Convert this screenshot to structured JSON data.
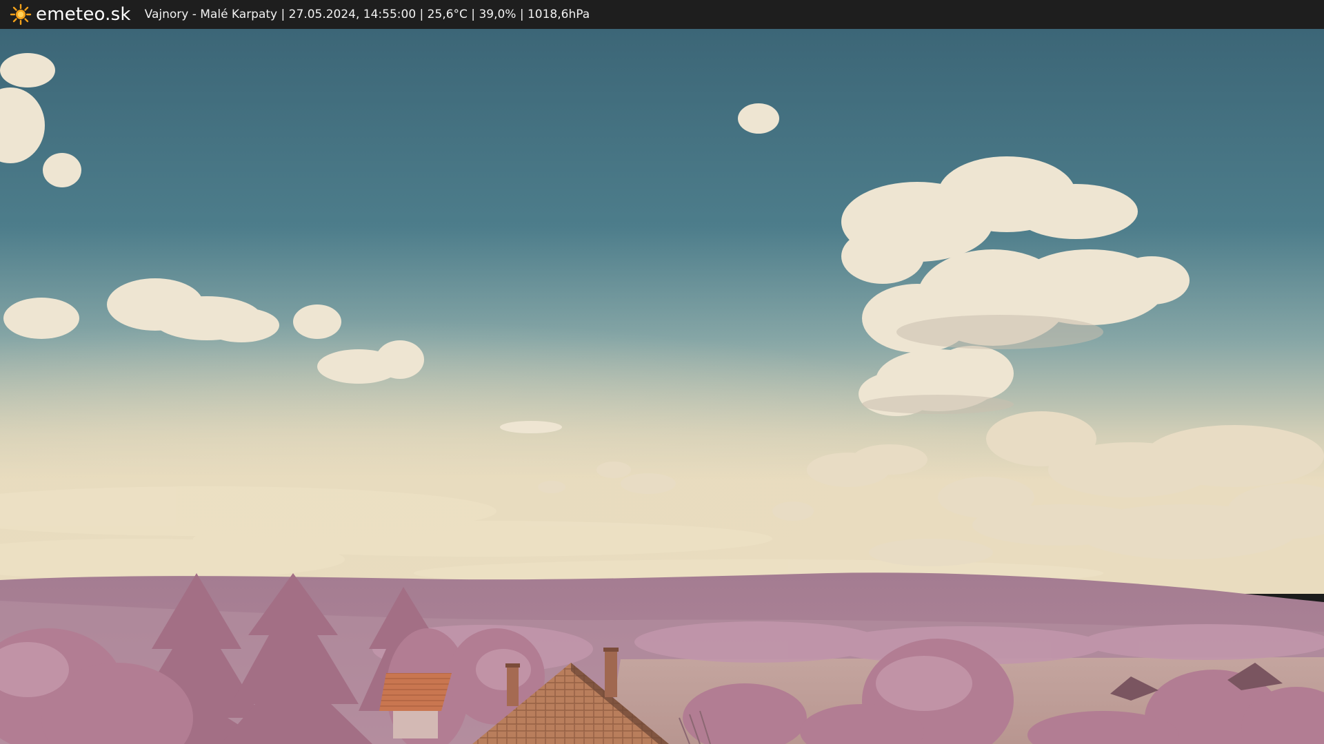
{
  "header": {
    "brand": "emeteo.sk",
    "caption": "Vajnory - Malé Karpaty | 27.05.2024, 14:55:00 | 25,6°C | 39,0% | 1018,6hPa",
    "brand_icon": "sun-icon"
  },
  "colors": {
    "bar": "#1e1e1e",
    "sun": "#f4a21a",
    "sky_top": "#3e6878",
    "sky_horizon": "#e9dcc0",
    "foliage": "#b98298",
    "roof": "#c77a52"
  }
}
